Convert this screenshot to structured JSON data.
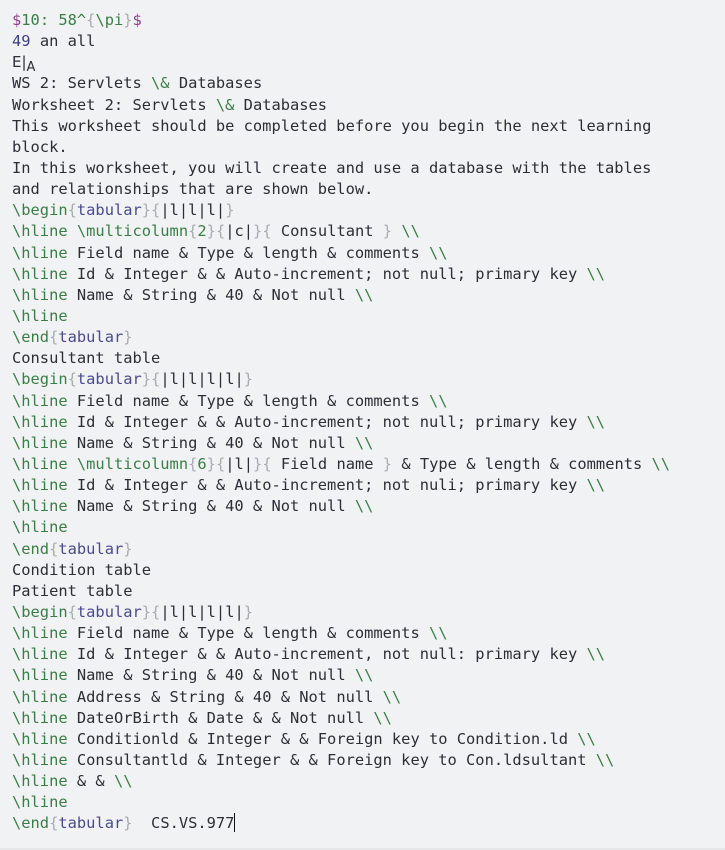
{
  "editor": {
    "lines": [
      [
        {
          "t": "$",
          "c": "dollar"
        },
        {
          "t": "10: 58^",
          "c": "math"
        },
        {
          "t": "{",
          "c": "brace"
        },
        {
          "t": "\\pi",
          "c": "math"
        },
        {
          "t": "}",
          "c": "brace"
        },
        {
          "t": "$",
          "c": "dollar"
        }
      ],
      [
        {
          "t": "49",
          "c": "numlit"
        },
        {
          "t": " an all",
          "c": "text"
        }
      ],
      [
        {
          "t": "E|",
          "c": "sub"
        },
        {
          "t": "A",
          "c": "small"
        }
      ],
      [
        {
          "t": "WS 2: Servlets ",
          "c": "text"
        },
        {
          "t": "\\&",
          "c": "cmd"
        },
        {
          "t": " Databases",
          "c": "text"
        }
      ],
      [
        {
          "t": "Worksheet 2: Servlets ",
          "c": "text"
        },
        {
          "t": "\\&",
          "c": "cmd"
        },
        {
          "t": " Databases",
          "c": "text"
        }
      ],
      [
        {
          "t": "This worksheet should be completed before you begin the next learning",
          "c": "text"
        }
      ],
      [
        {
          "t": "block.",
          "c": "text"
        }
      ],
      [
        {
          "t": "In this worksheet, you will create and use a database with the tables",
          "c": "text"
        }
      ],
      [
        {
          "t": "and relationships that are shown below.",
          "c": "text"
        }
      ],
      [
        {
          "t": "\\begin",
          "c": "cmd"
        },
        {
          "t": "{",
          "c": "brace"
        },
        {
          "t": "tabular",
          "c": "arg"
        },
        {
          "t": "}",
          "c": "brace"
        },
        {
          "t": "{",
          "c": "brace"
        },
        {
          "t": "|l|l|l|",
          "c": "spec"
        },
        {
          "t": "}",
          "c": "brace"
        }
      ],
      [
        {
          "t": "\\hline",
          "c": "cmd"
        },
        {
          "t": " ",
          "c": "text"
        },
        {
          "t": "\\multicolumn",
          "c": "cmd"
        },
        {
          "t": "{",
          "c": "brace"
        },
        {
          "t": "2",
          "c": "num"
        },
        {
          "t": "}",
          "c": "brace"
        },
        {
          "t": "{",
          "c": "brace"
        },
        {
          "t": "|c|",
          "c": "spec"
        },
        {
          "t": "}",
          "c": "brace"
        },
        {
          "t": "{",
          "c": "brace"
        },
        {
          "t": " Consultant ",
          "c": "text"
        },
        {
          "t": "}",
          "c": "brace"
        },
        {
          "t": " ",
          "c": "text"
        },
        {
          "t": "\\\\",
          "c": "cmd"
        }
      ],
      [
        {
          "t": "\\hline",
          "c": "cmd"
        },
        {
          "t": " Field name & Type & length & comments ",
          "c": "text"
        },
        {
          "t": "\\\\",
          "c": "cmd"
        }
      ],
      [
        {
          "t": "\\hline",
          "c": "cmd"
        },
        {
          "t": " Id & Integer & & Auto-increment; not null; primary key ",
          "c": "text"
        },
        {
          "t": "\\\\",
          "c": "cmd"
        }
      ],
      [
        {
          "t": "\\hline",
          "c": "cmd"
        },
        {
          "t": " Name & String & 40 & Not null ",
          "c": "text"
        },
        {
          "t": "\\\\",
          "c": "cmd"
        }
      ],
      [
        {
          "t": "\\hline",
          "c": "cmd"
        }
      ],
      [
        {
          "t": "\\end",
          "c": "cmd"
        },
        {
          "t": "{",
          "c": "brace"
        },
        {
          "t": "tabular",
          "c": "arg"
        },
        {
          "t": "}",
          "c": "brace"
        }
      ],
      [
        {
          "t": "Consultant table",
          "c": "text"
        }
      ],
      [
        {
          "t": "\\begin",
          "c": "cmd"
        },
        {
          "t": "{",
          "c": "brace"
        },
        {
          "t": "tabular",
          "c": "arg"
        },
        {
          "t": "}",
          "c": "brace"
        },
        {
          "t": "{",
          "c": "brace"
        },
        {
          "t": "|l|l|l|l|",
          "c": "spec"
        },
        {
          "t": "}",
          "c": "brace"
        }
      ],
      [
        {
          "t": "\\hline",
          "c": "cmd"
        },
        {
          "t": " Field name & Type & length & comments ",
          "c": "text"
        },
        {
          "t": "\\\\",
          "c": "cmd"
        }
      ],
      [
        {
          "t": "\\hline",
          "c": "cmd"
        },
        {
          "t": " Id & Integer & & Auto-increment; not null; primary key ",
          "c": "text"
        },
        {
          "t": "\\\\",
          "c": "cmd"
        }
      ],
      [
        {
          "t": "\\hline",
          "c": "cmd"
        },
        {
          "t": " Name & String & 40 & Not null ",
          "c": "text"
        },
        {
          "t": "\\\\",
          "c": "cmd"
        }
      ],
      [
        {
          "t": "\\hline",
          "c": "cmd"
        },
        {
          "t": " ",
          "c": "text"
        },
        {
          "t": "\\multicolumn",
          "c": "cmd"
        },
        {
          "t": "{",
          "c": "brace"
        },
        {
          "t": "6",
          "c": "num"
        },
        {
          "t": "}",
          "c": "brace"
        },
        {
          "t": "{",
          "c": "brace"
        },
        {
          "t": "|l|",
          "c": "spec"
        },
        {
          "t": "}",
          "c": "brace"
        },
        {
          "t": "{",
          "c": "brace"
        },
        {
          "t": " Field name ",
          "c": "text"
        },
        {
          "t": "}",
          "c": "brace"
        },
        {
          "t": " & Type & length & comments ",
          "c": "text"
        },
        {
          "t": "\\\\",
          "c": "cmd"
        }
      ],
      [
        {
          "t": "\\hline",
          "c": "cmd"
        },
        {
          "t": " Id & Integer & & Auto-increment; not nuli; primary key ",
          "c": "text"
        },
        {
          "t": "\\\\",
          "c": "cmd"
        }
      ],
      [
        {
          "t": "\\hline",
          "c": "cmd"
        },
        {
          "t": " Name & String & 40 & Not null ",
          "c": "text"
        },
        {
          "t": "\\\\",
          "c": "cmd"
        }
      ],
      [
        {
          "t": "\\hline",
          "c": "cmd"
        }
      ],
      [
        {
          "t": "\\end",
          "c": "cmd"
        },
        {
          "t": "{",
          "c": "brace"
        },
        {
          "t": "tabular",
          "c": "arg"
        },
        {
          "t": "}",
          "c": "brace"
        }
      ],
      [
        {
          "t": "Condition table",
          "c": "text"
        }
      ],
      [
        {
          "t": "Patient table",
          "c": "text"
        }
      ],
      [
        {
          "t": "\\begin",
          "c": "cmd"
        },
        {
          "t": "{",
          "c": "brace"
        },
        {
          "t": "tabular",
          "c": "arg"
        },
        {
          "t": "}",
          "c": "brace"
        },
        {
          "t": "{",
          "c": "brace"
        },
        {
          "t": "|l|l|l|l|",
          "c": "spec"
        },
        {
          "t": "}",
          "c": "brace"
        }
      ],
      [
        {
          "t": "\\hline",
          "c": "cmd"
        },
        {
          "t": " Field name & Type & length & comments ",
          "c": "text"
        },
        {
          "t": "\\\\",
          "c": "cmd"
        }
      ],
      [
        {
          "t": "\\hline",
          "c": "cmd"
        },
        {
          "t": " Id & Integer & & Auto-increment, not null: primary key ",
          "c": "text"
        },
        {
          "t": "\\\\",
          "c": "cmd"
        }
      ],
      [
        {
          "t": "\\hline",
          "c": "cmd"
        },
        {
          "t": " Name & String & 40 & Not null ",
          "c": "text"
        },
        {
          "t": "\\\\",
          "c": "cmd"
        }
      ],
      [
        {
          "t": "\\hline",
          "c": "cmd"
        },
        {
          "t": " Address & String & 40 & Not null ",
          "c": "text"
        },
        {
          "t": "\\\\",
          "c": "cmd"
        }
      ],
      [
        {
          "t": "\\hline",
          "c": "cmd"
        },
        {
          "t": " DateOrBirth & Date & & Not null ",
          "c": "text"
        },
        {
          "t": "\\\\",
          "c": "cmd"
        }
      ],
      [
        {
          "t": "\\hline",
          "c": "cmd"
        },
        {
          "t": " Conditionld & Integer & & Foreign key to Condition.ld ",
          "c": "text"
        },
        {
          "t": "\\\\",
          "c": "cmd"
        }
      ],
      [
        {
          "t": "\\hline",
          "c": "cmd"
        },
        {
          "t": " Consultantld & Integer & & Foreign key to Con.ldsultant ",
          "c": "text"
        },
        {
          "t": "\\\\",
          "c": "cmd"
        }
      ],
      [
        {
          "t": "\\hline",
          "c": "cmd"
        },
        {
          "t": " & & ",
          "c": "text"
        },
        {
          "t": "\\\\",
          "c": "cmd"
        }
      ],
      [
        {
          "t": "\\hline",
          "c": "cmd"
        }
      ],
      [
        {
          "t": "\\end",
          "c": "cmd"
        },
        {
          "t": "{",
          "c": "brace"
        },
        {
          "t": "tabular",
          "c": "arg"
        },
        {
          "t": "}",
          "c": "brace"
        },
        {
          "t": "  CS.VS.977",
          "c": "text"
        },
        {
          "t": "",
          "c": "caret"
        }
      ]
    ]
  }
}
